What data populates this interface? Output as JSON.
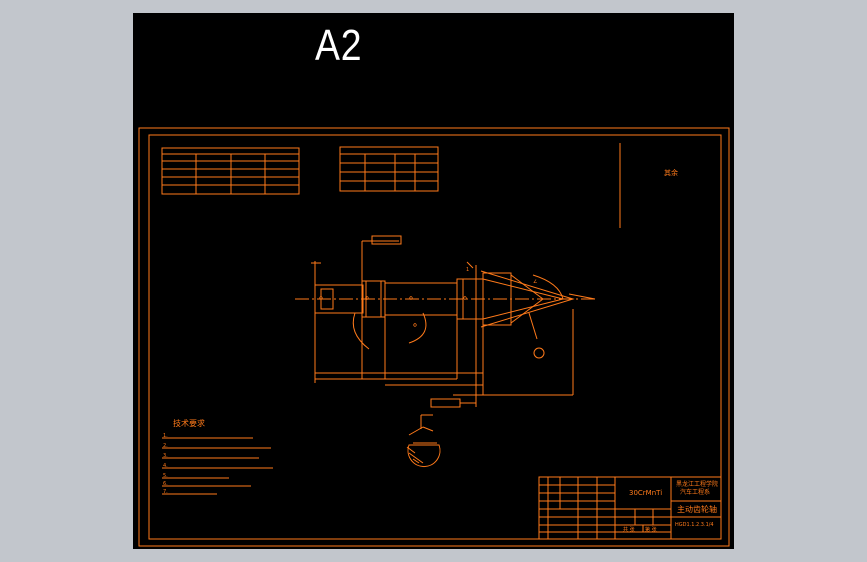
{
  "sheet": {
    "size_label": "A2"
  },
  "colors": {
    "background": "#000000",
    "linework": "#ff7a1a",
    "chrome": "#c2c6cc",
    "label": "#ffffff"
  },
  "drawing": {
    "material": "30CrMnTi",
    "part_title": "主动齿轮轴",
    "school": "黑龙江工程学院",
    "department": "汽车工程系",
    "roughness_note": "其余",
    "tech_requirements_title": "技术要求",
    "tech_requirements_lines": [
      "1.",
      "2.",
      "3.",
      "4.",
      "5.",
      "6.",
      "7."
    ],
    "sheet_info_left": "共 张",
    "sheet_info_right": "第 张",
    "drawing_number": "HGD1.1.2.3.1/4"
  }
}
